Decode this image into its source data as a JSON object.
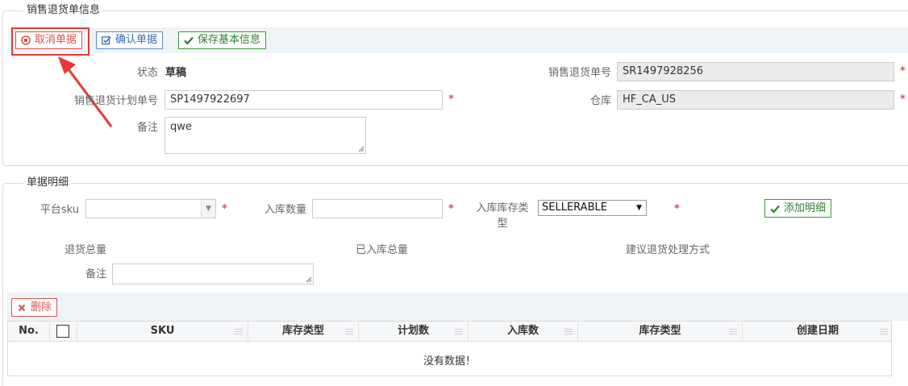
{
  "header": {
    "section_title": "销售退货单信息",
    "buttons": {
      "cancel": "取消单据",
      "confirm": "确认单据",
      "save": "保存基本信息"
    }
  },
  "form": {
    "status_label": "状态",
    "status_value": "草稿",
    "return_no_label": "销售退货单号",
    "return_no_value": "SR1497928256",
    "plan_no_label": "销售退货计划单号",
    "plan_no_value": "SP1497922697",
    "warehouse_label": "仓库",
    "warehouse_value": "HF_CA_US",
    "remark_label": "备注",
    "remark_value": "qwe",
    "required_mark": "*"
  },
  "detail": {
    "section_title": "单据明细",
    "platform_sku_label": "平台sku",
    "in_qty_label": "入库数量",
    "stock_type_label_1": "入库库存类",
    "stock_type_label_2": "型",
    "stock_type_value": "SELLERABLE",
    "add_button": "添加明细",
    "return_total_label": "退货总量",
    "received_total_label": "已入库总量",
    "suggest_label": "建议退货处理方式",
    "remark_label": "备注",
    "delete_button": "删除"
  },
  "grid": {
    "columns": [
      "No.",
      "",
      "SKU",
      "库存类型",
      "计划数",
      "入库数",
      "库存类型",
      "创建日期"
    ],
    "empty_text": "没有数据！"
  },
  "colors": {
    "danger": "#d9534f",
    "primary": "#2f6fb5",
    "success": "#2e7d2e",
    "annotation": "#e53935"
  }
}
